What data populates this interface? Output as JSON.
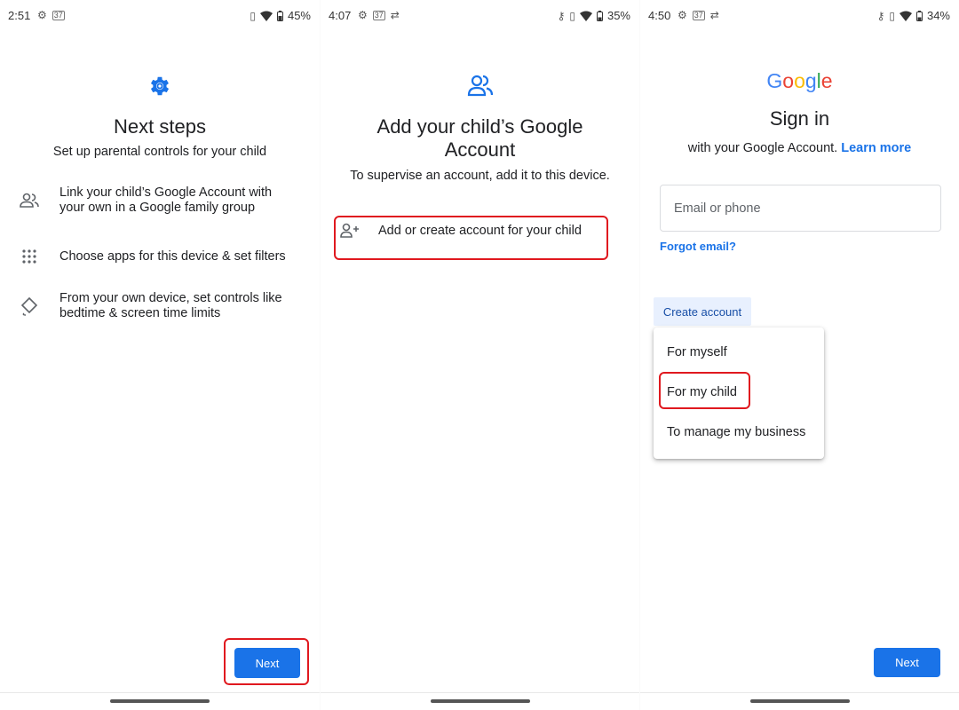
{
  "panel1": {
    "status": {
      "time": "2:51",
      "battery": "45%"
    },
    "title": "Next steps",
    "subtitle": "Set up parental controls for your child",
    "steps": [
      {
        "icon": "people-icon",
        "text_line1": "Link your child’s Google Account with",
        "text_line2": "your own in a Google family group"
      },
      {
        "icon": "apps-grid-icon",
        "text_line1": "Choose apps for this device & set filters",
        "text_line2": ""
      },
      {
        "icon": "diamond-rotate-icon",
        "text_line1": "From your own device, set controls like",
        "text_line2": "bedtime & screen time limits"
      }
    ],
    "next_label": "Next"
  },
  "panel2": {
    "status": {
      "time": "4:07",
      "battery": "35%"
    },
    "title_line1": "Add your child’s Google",
    "title_line2": "Account",
    "subtitle": "To supervise an account, add it to this device.",
    "add_account_label": "Add or create account for your child"
  },
  "panel3": {
    "status": {
      "time": "4:50",
      "battery": "34%"
    },
    "logo": "Google",
    "title": "Sign in",
    "subtitle_text": "with your Google Account.",
    "learn_more": "Learn more",
    "email_placeholder": "Email or phone",
    "forgot_email": "Forgot email?",
    "create_account": "Create account",
    "menu": [
      "For myself",
      "For my child",
      "To manage my business"
    ],
    "next_label": "Next"
  },
  "colors": {
    "accent": "#1a73e8",
    "highlight": "#e0191f"
  }
}
